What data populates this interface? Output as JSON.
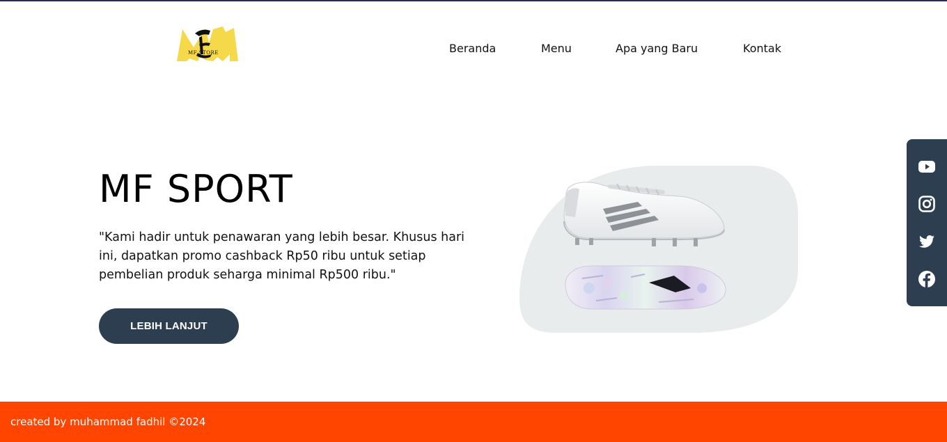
{
  "brand": {
    "logo_text": "MF STORE",
    "logo_color": "#f5d94a"
  },
  "nav": {
    "items": [
      {
        "label": "Beranda"
      },
      {
        "label": "Menu"
      },
      {
        "label": "Apa yang Baru"
      },
      {
        "label": "Kontak"
      }
    ]
  },
  "hero": {
    "title": "MF SPORT",
    "text": "\"Kami hadir untuk penawaran yang lebih besar. Khusus hari ini, dapatkan promo cashback Rp50 ribu untuk setiap pembelian produk seharga minimal Rp500 ribu.\"",
    "cta_label": "LEBIH LANJUT",
    "cta_color": "#2c3e50"
  },
  "social": {
    "background": "#2c3e50",
    "icons": [
      "youtube-icon",
      "instagram-icon",
      "twitter-icon",
      "facebook-icon"
    ]
  },
  "footer": {
    "text": "created by muhammad fadhil ©2024",
    "background": "#ff4500"
  }
}
